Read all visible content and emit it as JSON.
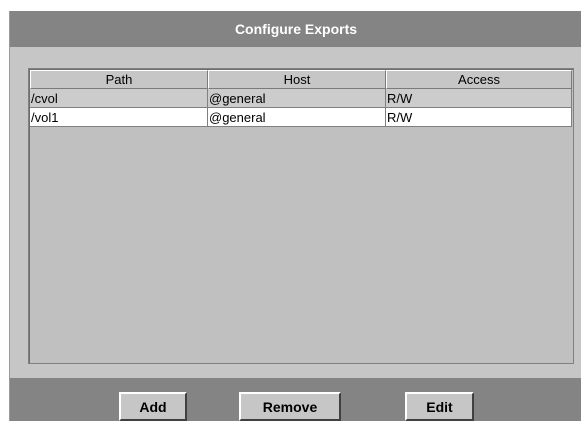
{
  "dialog": {
    "title": "Configure Exports"
  },
  "table": {
    "columns": [
      "Path",
      "Host",
      "Access"
    ],
    "rows": [
      {
        "path": "/cvol",
        "host": "@general",
        "access": "R/W",
        "selected": true
      },
      {
        "path": "/vol1",
        "host": "@general",
        "access": "R/W",
        "selected": false
      }
    ]
  },
  "buttons": {
    "add": "Add",
    "remove": "Remove",
    "edit": "Edit"
  }
}
